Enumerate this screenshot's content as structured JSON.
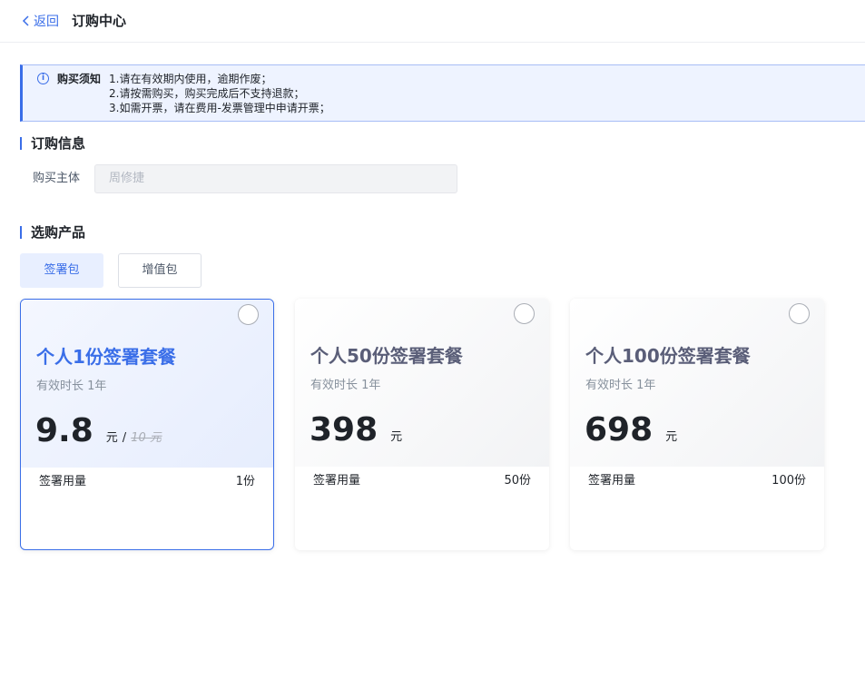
{
  "header": {
    "back_label": "返回",
    "title": "订购中心"
  },
  "notice": {
    "title": "购买须知",
    "lines": [
      "1.请在有效期内使用，逾期作废；",
      "2.请按需购买，购买完成后不支持退款；",
      "3.如需开票，请在费用-发票管理中申请开票；"
    ]
  },
  "order_info": {
    "section_title": "订购信息",
    "subject_label": "购买主体",
    "subject_value": "周修捷"
  },
  "products": {
    "section_title": "选购产品",
    "tabs": [
      {
        "label": "签署包",
        "active": true
      },
      {
        "label": "增值包",
        "active": false
      }
    ],
    "cards": [
      {
        "name": "个人1份签署套餐",
        "validity": "有效时长 1年",
        "price": "9.8",
        "unit": "元",
        "slash": "/",
        "original_price": "10 元",
        "usage_label": "签署用量",
        "usage_value": "1份",
        "selected": true
      },
      {
        "name": "个人50份签署套餐",
        "validity": "有效时长 1年",
        "price": "398",
        "unit": "元",
        "usage_label": "签署用量",
        "usage_value": "50份",
        "selected": false
      },
      {
        "name": "个人100份签署套餐",
        "validity": "有效时长 1年",
        "price": "698",
        "unit": "元",
        "usage_label": "签署用量",
        "usage_value": "100份",
        "selected": false
      }
    ]
  },
  "colors": {
    "accent": "#3a6ee8",
    "notice_bg": "#eef3ff",
    "text": "#1f2329",
    "muted": "#86909c"
  },
  "icons": {
    "back": "chevron-left-icon",
    "notice": "info-icon",
    "card_select": "radio-icon"
  }
}
